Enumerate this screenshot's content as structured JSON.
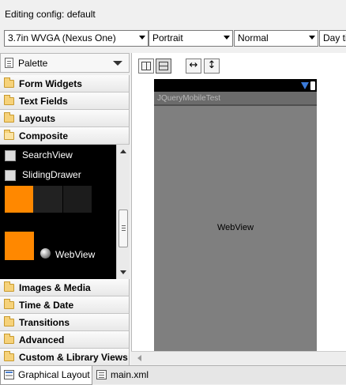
{
  "config": {
    "label": "Editing config:",
    "value": "default"
  },
  "dropdowns": {
    "device": "3.7in WVGA (Nexus One)",
    "orientation": "Portrait",
    "mode": "Normal",
    "time": "Day ti"
  },
  "palette": {
    "title": "Palette",
    "categories_top": [
      "Form Widgets",
      "Text Fields",
      "Layouts",
      "Composite"
    ],
    "composite_items": {
      "search_view": "SearchView",
      "sliding_drawer": "SlidingDrawer",
      "web_view": "WebView"
    },
    "categories_bottom": [
      "Images & Media",
      "Time & Date",
      "Transitions",
      "Advanced",
      "Custom & Library Views"
    ]
  },
  "device": {
    "app_title": "JQueryMobileTest",
    "content_label": "WebView"
  },
  "tabs": {
    "graphical_layout": "Graphical Layout",
    "main_xml": "main.xml"
  },
  "colors": {
    "accent_orange": "#ff8800",
    "device_screen": "#7f7f7f",
    "status_signal": "#3a7ad8"
  },
  "icons": {
    "palette": "palette-icon",
    "folder": "folder-icon",
    "search": "search-icon",
    "sliding_drawer": "sliding-drawer-icon",
    "globe": "globe-icon"
  }
}
